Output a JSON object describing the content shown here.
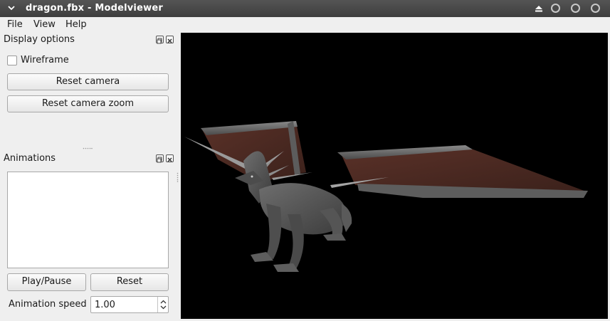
{
  "window": {
    "title": "dragon.fbx - Modelviewer"
  },
  "menubar": {
    "items": [
      "File",
      "View",
      "Help"
    ]
  },
  "display_options": {
    "title": "Display options",
    "wireframe_label": "Wireframe",
    "wireframe_checked": false,
    "reset_camera_label": "Reset camera",
    "reset_camera_zoom_label": "Reset camera zoom"
  },
  "animations": {
    "title": "Animations",
    "list_items": [],
    "play_pause_label": "Play/Pause",
    "reset_label": "Reset",
    "speed_label": "Animation speed",
    "speed_value": "1.00"
  },
  "viewport": {
    "background": "#000000",
    "model": "dragon"
  },
  "colors": {
    "titlebar": "#484848",
    "window_bg": "#efefef",
    "wing_membrane": "#4a2a22",
    "dragon_body": "#5a5a5a"
  }
}
